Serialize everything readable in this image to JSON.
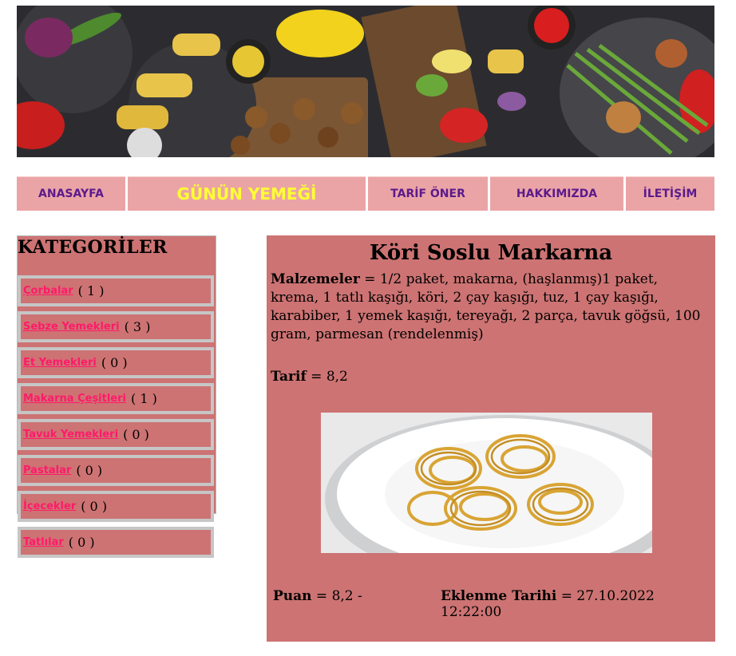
{
  "nav": {
    "items": [
      {
        "label": "ANASAYFA"
      },
      {
        "label": "GÜNÜN YEMEĞİ"
      },
      {
        "label": "TARİF ÖNER"
      },
      {
        "label": "HAKKIMIZDA"
      },
      {
        "label": "İLETİŞİM"
      }
    ]
  },
  "categories": {
    "title": "KATEGORİLER",
    "items": [
      {
        "label": "Çorbalar",
        "count": "( 1 )"
      },
      {
        "label": "Sebze Yemekleri",
        "count": "( 3 )"
      },
      {
        "label": "Et Yemekleri",
        "count": "( 0 )"
      },
      {
        "label": "Makarna Çeşitleri",
        "count": "( 1 )"
      },
      {
        "label": "Tavuk Yemekleri",
        "count": "( 0 )"
      },
      {
        "label": "Pastalar",
        "count": "( 0 )"
      },
      {
        "label": "İçecekler",
        "count": "( 0 )"
      },
      {
        "label": "Tatlılar",
        "count": "( 0 )"
      }
    ]
  },
  "recipe": {
    "title": "Köri Soslu Markarna",
    "ingredients_label": "Malzemeler",
    "ingredients_text": " = 1/2 paket, makarna, (haşlanmış)1 paket, krema, 1 tatlı kaşığı, köri, 2 çay kaşığı, tuz, 1 çay kaşığı, karabiber, 1 yemek kaşığı, tereyağı, 2 parça, tavuk göğsü, 100 gram, parmesan (rendelenmiş)",
    "tarif_label": "Tarif",
    "tarif_value": " = 8,2",
    "puan_label": "Puan",
    "puan_value": " = 8,2  -",
    "date_label": "Eklenme Tarihi",
    "date_value": "  = 27.10.2022 12:22:00"
  },
  "colors": {
    "panel": "#cd7373",
    "nav_bg": "#eba4a6",
    "nav_text": "#5b1a8c",
    "nav_active": "#ffff33",
    "category_link": "#ff1a6a"
  }
}
